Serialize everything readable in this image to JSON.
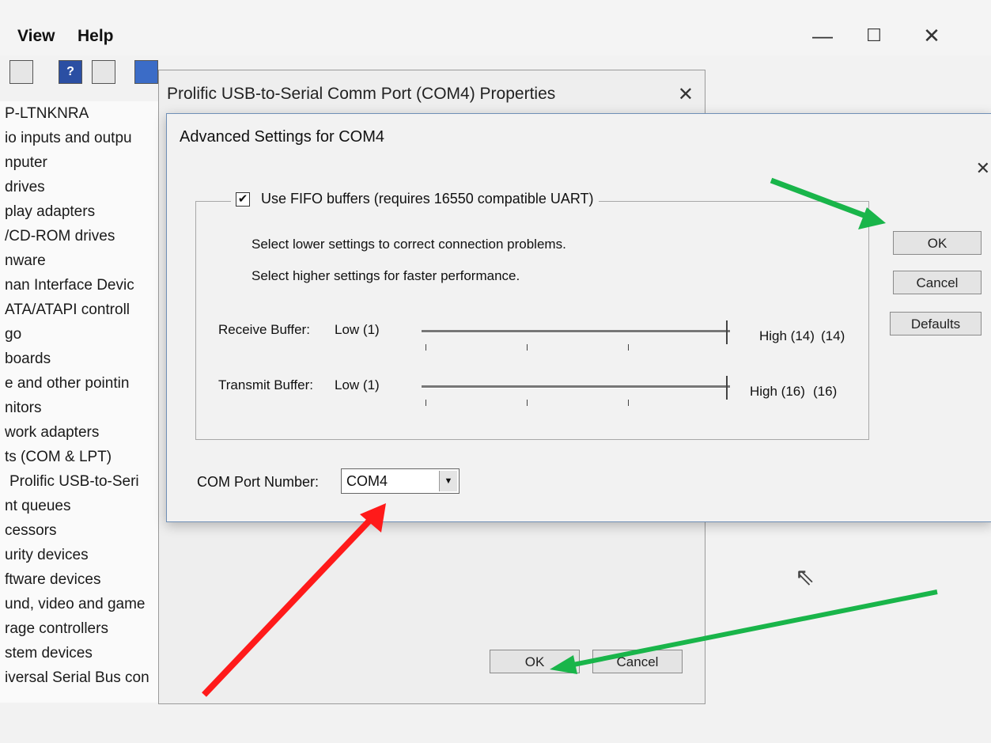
{
  "device_manager": {
    "menu": [
      "View",
      "Help"
    ],
    "tree_items": [
      "P-LTNKNRA",
      "io inputs and outpu",
      "nputer",
      "drives",
      "play adapters",
      "/CD-ROM drives",
      "nware",
      "nan Interface Devic",
      "ATA/ATAPI controll",
      "go",
      "boards",
      "e and other pointin",
      "nitors",
      "work adapters",
      "ts (COM & LPT)",
      "Prolific USB-to-Seri",
      "nt queues",
      "cessors",
      "urity devices",
      "ftware devices",
      "und, video and game",
      "rage controllers",
      "stem devices",
      "iversal Serial Bus con"
    ]
  },
  "properties_dialog": {
    "title": "Prolific USB-to-Serial Comm Port (COM4) Properties",
    "ok_label": "OK",
    "cancel_label": "Cancel"
  },
  "advanced_dialog": {
    "title": "Advanced Settings for COM4",
    "fifo_label": "Use FIFO buffers (requires 16550 compatible UART)",
    "fifo_checked": true,
    "info_lower": "Select lower settings to correct connection problems.",
    "info_higher": "Select higher settings for faster performance.",
    "receive": {
      "label": "Receive Buffer:",
      "low": "Low (1)",
      "high": "High (14)",
      "value": "(14)",
      "level": 1.0
    },
    "transmit": {
      "label": "Transmit Buffer:",
      "low": "Low (1)",
      "high": "High (16)",
      "value": "(16)",
      "level": 1.0
    },
    "com_port_label": "COM Port Number:",
    "com_port_value": "COM4",
    "ok_label": "OK",
    "cancel_label": "Cancel",
    "defaults_label": "Defaults"
  },
  "annotation_colors": {
    "red": "#ff1a1a",
    "green": "#19b54a"
  }
}
